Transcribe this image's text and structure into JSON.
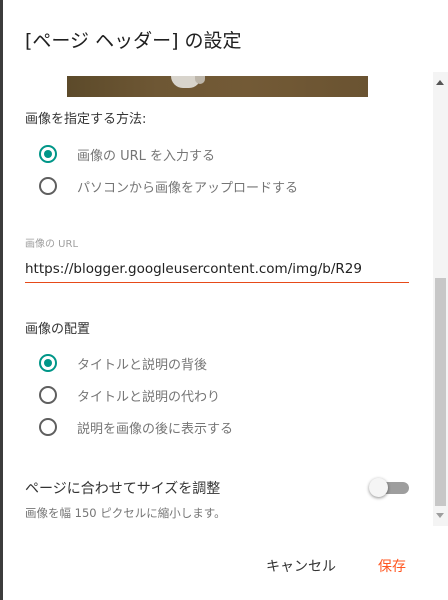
{
  "dialog": {
    "title": "[ページ ヘッダー] の設定"
  },
  "image_method": {
    "label": "画像を指定する方法:",
    "options": [
      {
        "label": "画像の URL を入力する",
        "checked": true
      },
      {
        "label": "パソコンから画像をアップロードする",
        "checked": false
      }
    ]
  },
  "url_field": {
    "label": "画像の URL",
    "value": "https://blogger.googleusercontent.com/img/b/R29"
  },
  "placement": {
    "label": "画像の配置",
    "options": [
      {
        "label": "タイトルと説明の背後",
        "checked": true
      },
      {
        "label": "タイトルと説明の代わり",
        "checked": false
      },
      {
        "label": "説明を画像の後に表示する",
        "checked": false
      }
    ]
  },
  "shrink": {
    "label": "ページに合わせてサイズを調整",
    "hint": "画像を幅 150 ピクセルに縮小します。",
    "enabled": false
  },
  "footer": {
    "cancel_label": "キャンセル",
    "save_label": "保存"
  },
  "colors": {
    "accent": "#009688",
    "save": "#ff5722",
    "input_underline": "#e64a19"
  }
}
